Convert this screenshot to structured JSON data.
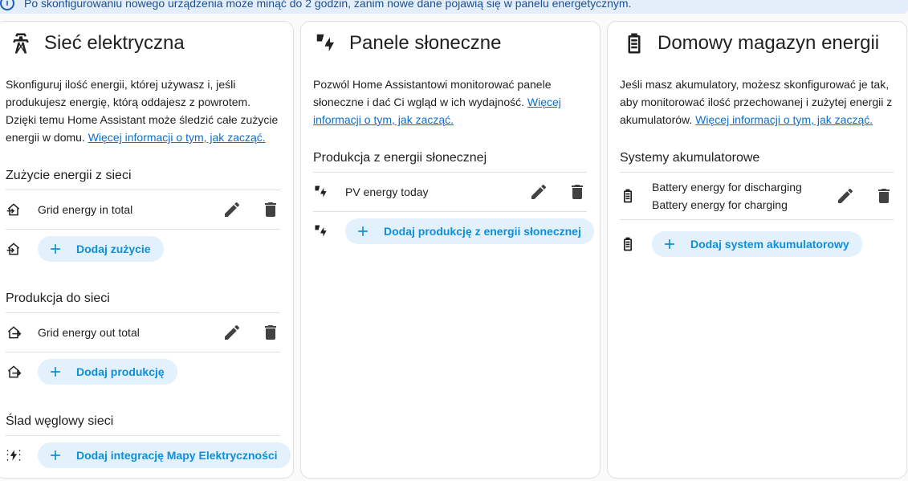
{
  "alert": {
    "text": "Po skonfigurowaniu nowego urządzenia może minąć do 2 godzin, zanim nowe dane pojawią się w panelu energetycznym."
  },
  "grid_card": {
    "title": "Sieć elektryczna",
    "description": "Skonfiguruj ilość energii, której używasz i, jeśli produkujesz energię, którą oddajesz z powrotem. Dzięki temu Home Assistant może śledzić całe zużycie energii w domu. ",
    "link": "Więcej informacji o tym, jak zacząć.",
    "consumption_title": "Zużycie energii z sieci",
    "consumption_item": "Grid energy in total",
    "add_consumption": "Dodaj zużycie",
    "production_title": "Produkcja do sieci",
    "production_item": "Grid energy out total",
    "add_production": "Dodaj produkcję",
    "carbon_title": "Ślad węglowy sieci",
    "add_carbon": "Dodaj integrację Mapy Elektryczności"
  },
  "solar_card": {
    "title": "Panele słoneczne",
    "description": "Pozwól Home Assistantowi monitorować panele słoneczne i dać Ci wgląd w ich wydajność. ",
    "link": "Więcej informacji o tym, jak zacząć.",
    "section_title": "Produkcja z energii słonecznej",
    "item": "PV energy today",
    "add_button": "Dodaj produkcję z energii słonecznej"
  },
  "battery_card": {
    "title": "Domowy magazyn energii",
    "description": "Jeśli masz akumulatory, możesz skonfigurować je tak, aby monitorować ilość przechowanej i zużytej energii z akumulatorów. ",
    "link": "Więcej informacji o tym, jak zacząć.",
    "section_title": "Systemy akumulatorowe",
    "item_discharging": "Battery energy for discharging",
    "item_charging": "Battery energy for charging",
    "add_button": "Dodaj system akumulatorowy"
  },
  "colors": {
    "accent": "#0d8fd9",
    "link": "#0d6ec9",
    "alert_bg": "#e3eefa"
  },
  "icons": [
    "info-icon",
    "transmission-tower-icon",
    "solar-power-icon",
    "battery-icon",
    "home-import-icon",
    "home-export-icon",
    "carbon-icon",
    "pencil-icon",
    "delete-icon",
    "plus-icon"
  ]
}
